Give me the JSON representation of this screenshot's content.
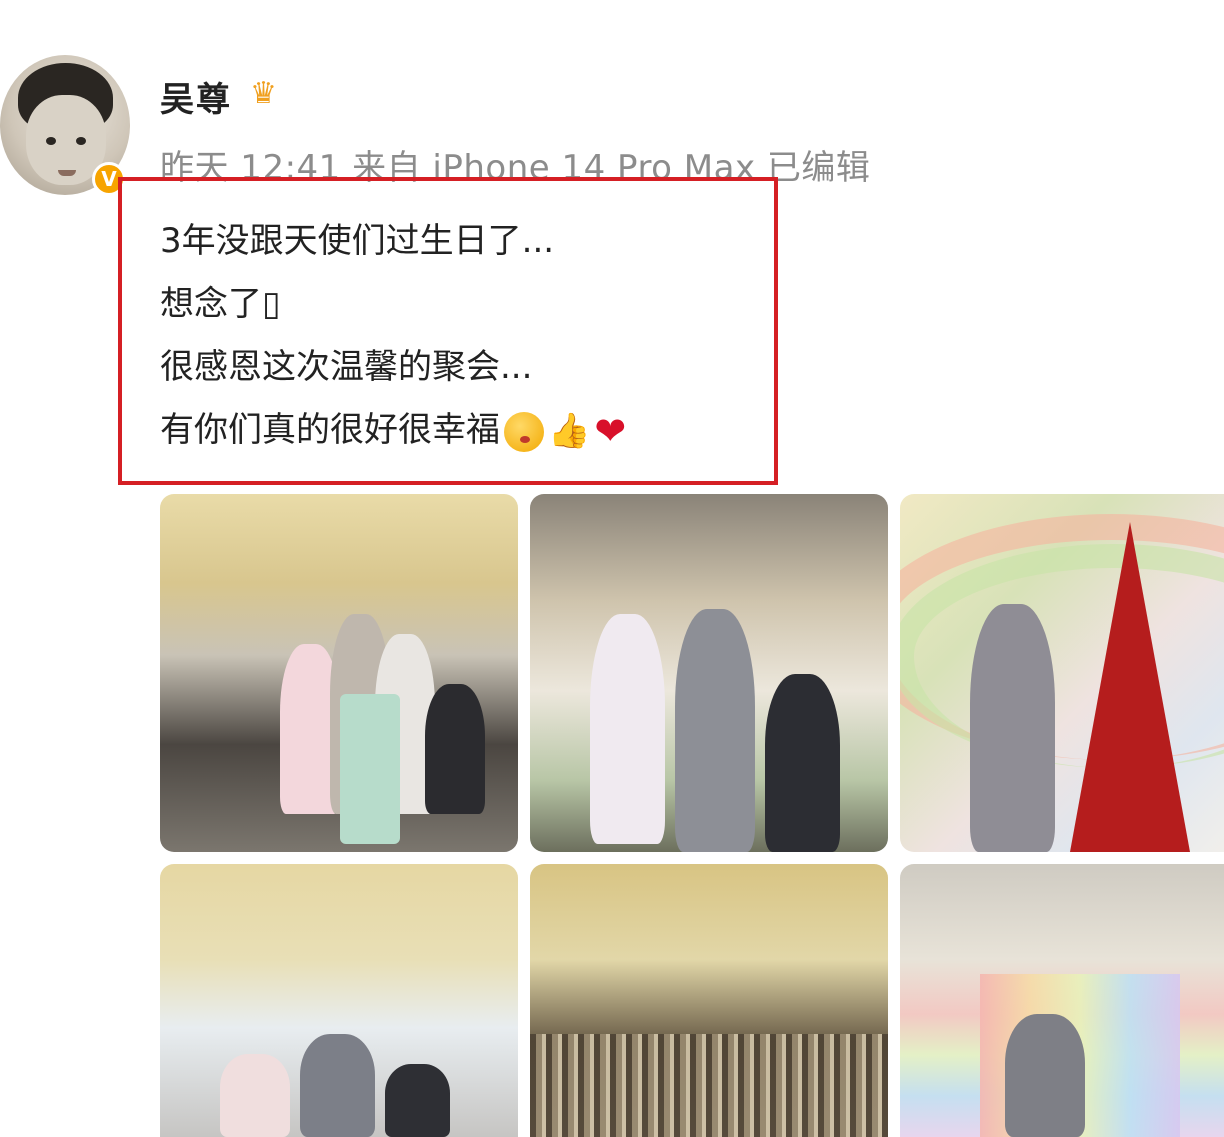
{
  "post": {
    "username": "吴尊",
    "meta": "昨天 12:41 来自 iPhone 14 Pro Max 已编辑",
    "text_lines": [
      "3年没跟天使们过生日了...",
      "想念了▯",
      "很感恩这次温馨的聚会...",
      "有你们真的很好很幸福"
    ],
    "verified_badge": "V",
    "emoji_after_last_line": [
      "kiss-face-emoji",
      "thumbs-up-emoji",
      "red-heart-emoji"
    ]
  },
  "icons": {
    "crown": "crown-icon",
    "verified": "verified-badge-icon"
  },
  "colors": {
    "highlight_box": "#d51f24",
    "meta_text": "#8c8c8c",
    "badge": "#f7a400"
  }
}
